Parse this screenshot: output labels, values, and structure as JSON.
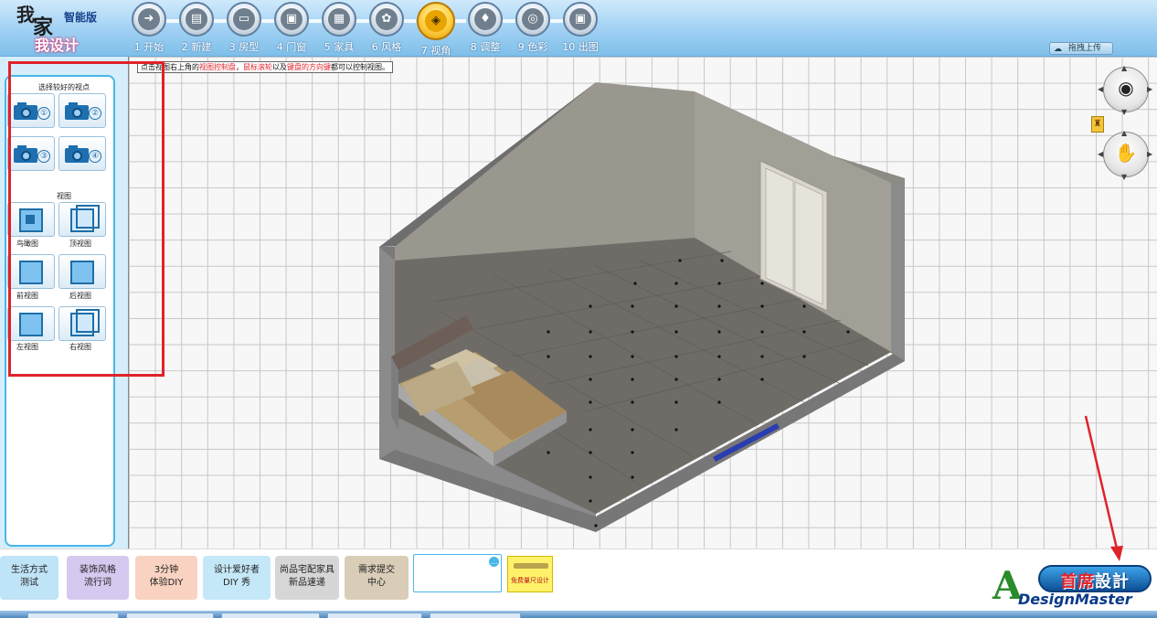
{
  "logo": {
    "wo": "我",
    "jia": "家",
    "edition": "智能版",
    "subtitle": "我设计"
  },
  "steps": [
    {
      "label": "1 开始",
      "glyph": "➜"
    },
    {
      "label": "2 新建",
      "glyph": "▤"
    },
    {
      "label": "3 房型",
      "glyph": "▭"
    },
    {
      "label": "4 门窗",
      "glyph": "▣"
    },
    {
      "label": "5 家具",
      "glyph": "▦"
    },
    {
      "label": "6 风格",
      "glyph": "✿"
    },
    {
      "label": "7 视角",
      "glyph": "◈",
      "active": true
    },
    {
      "label": "8 调整",
      "glyph": "♦"
    },
    {
      "label": "9 色彩",
      "glyph": "◎"
    },
    {
      "label": "10 出图",
      "glyph": "▣"
    }
  ],
  "header": {
    "upload_label": "拖拽上传"
  },
  "hint": {
    "part1": "点击视图右上角的",
    "highlight1": "视图控制盘",
    "part2": "，",
    "highlight2": "鼠标滚轮",
    "part3": "以及",
    "highlight3": "键盘的方向键",
    "part4": "都可以控制视图。"
  },
  "left_panel": {
    "viewpoint_title": "选择较好的视点",
    "viewpoints": [
      "①",
      "②",
      "③",
      "④"
    ],
    "views_title": "视图",
    "views": [
      "鸟瞰图",
      "顶视图",
      "前视图",
      "后视图",
      "左视图",
      "右视图"
    ]
  },
  "controls": {
    "eye_icon": "eye-icon",
    "hand_icon": "hand-icon"
  },
  "bottom": {
    "tiles": [
      {
        "l1": "生活方式",
        "l2": "测试",
        "color": "#bfe3f7"
      },
      {
        "l1": "装饰风格",
        "l2": "流行词",
        "color": "#d6c9ef"
      },
      {
        "l1": "3分钟",
        "l2": "体验DIY",
        "color": "#f9d2c2"
      },
      {
        "l1": "设计爱好者",
        "l2": "DIY 秀",
        "color": "#c4e8f7"
      },
      {
        "l1": "尚品宅配家具",
        "l2": "新品速递",
        "color": "#d6d6d6"
      },
      {
        "l1": "需求提交",
        "l2": "中心",
        "color": "#d9cdb7"
      }
    ],
    "banner_text": "免费量尺设计",
    "brand_cn_red": "首席",
    "brand_cn_white": "設計",
    "brand_en": "DesignMaster",
    "brand_a": "A"
  },
  "colors": {
    "accent": "#49b6e8",
    "highlight": "#e0222a",
    "active_step": "#ffc21c"
  }
}
